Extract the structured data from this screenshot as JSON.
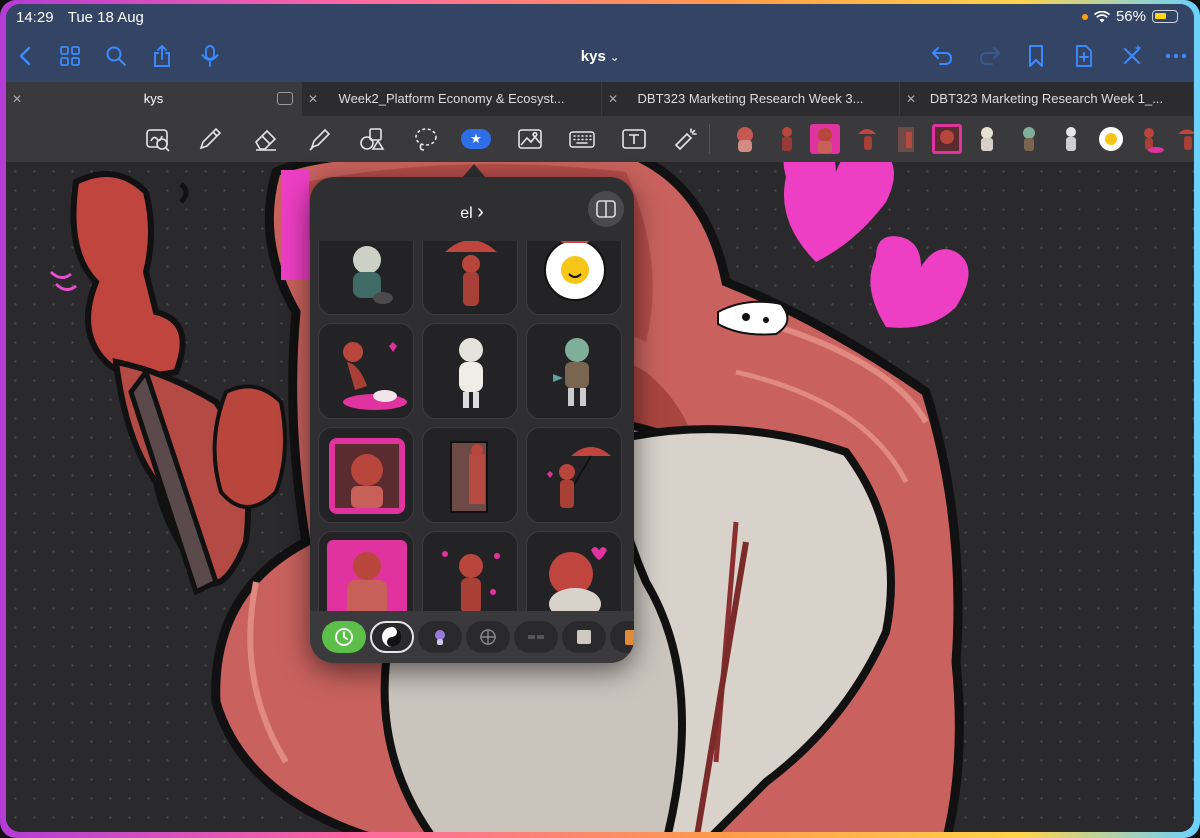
{
  "status_bar": {
    "time": "14:29",
    "date": "Tue 18 Aug",
    "battery_percent": "56%",
    "battery_level": 0.56,
    "icons": [
      "orange-dot-icon",
      "wifi-icon",
      "battery-icon"
    ]
  },
  "nav_bar": {
    "document_title": "kys",
    "left_icons": [
      "back-icon",
      "grid-icon",
      "search-icon",
      "share-icon",
      "microphone-icon"
    ],
    "right_icons": [
      "undo-icon",
      "redo-icon",
      "bookmark-icon",
      "add-page-icon",
      "close-sparkle-icon",
      "more-icon"
    ]
  },
  "tabs": [
    {
      "label": "kys",
      "active": true
    },
    {
      "label": "Week2_Platform Economy & Ecosyst...",
      "active": false
    },
    {
      "label": "DBT323 Marketing Research Week 3...",
      "active": false
    },
    {
      "label": "DBT323 Marketing Research Week 1_...",
      "active": false
    }
  ],
  "toolbar": {
    "tools": [
      "zoom-lasso-icon",
      "pen-icon",
      "eraser-icon",
      "highlighter-icon",
      "shapes-icon",
      "lasso-icon",
      "stickers-icon",
      "image-icon",
      "keyboard-icon",
      "text-box-icon",
      "laser-pointer-icon"
    ],
    "active_tool": "stickers-icon",
    "recent_sticker_count": 12
  },
  "sticker_popover": {
    "title": "el",
    "chevron": "›",
    "stickers": [
      "girl-with-cat-sticker",
      "red-umbrella-figure-sticker",
      "smiling-flower-sticker",
      "pink-puddle-figure-sticker",
      "white-hair-girl-sticker",
      "green-hair-elf-sticker",
      "red-hair-pink-frame-sticker",
      "door-figure-sticker",
      "umbrella-hearts-sticker",
      "pink-poster-figure-sticker",
      "red-flowers-figure-sticker",
      "sitting-hearts-sticker"
    ],
    "categories": [
      "recent-clock-icon",
      "yin-yang-icon",
      "purple-character-icon",
      "crosshair-icon",
      "dark-stickers-icon",
      "paper-icon",
      "orange-folder-icon"
    ],
    "active_category": "recent-clock-icon"
  }
}
